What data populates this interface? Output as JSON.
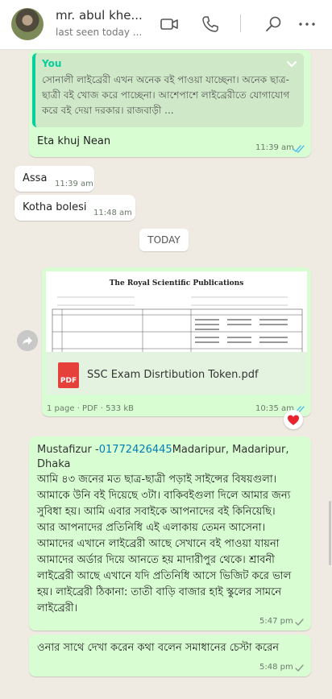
{
  "header": {
    "name": "mr. abul khe...",
    "status": "last seen today ..."
  },
  "messages": {
    "quoted_reply": {
      "quote_author": "You",
      "quote_text": "সোনালী লাইব্রেরী  এখন অনেক বই পাওয়া যাচ্ছেনা। অনেক ছাত্র-ছাত্রী বই খোজ করে পাচ্ছেনা।  আশেপাশে লাইব্রেরীতে যোগাযোগ করে বই দেয়া দরকার। রাজবাড়ী ...",
      "text": "Eta khuj Nean",
      "time": "11:39 am"
    },
    "assa": {
      "text": "Assa",
      "time": "11:39 am"
    },
    "kotha": {
      "text": "Kotha bolesi",
      "time": "11:48 am"
    },
    "date_divider": "TODAY",
    "document": {
      "preview_title": "The Royal Scientific Publications",
      "filename": "SSC Exam Disrtibution Token.pdf",
      "icon_label": "PDF",
      "meta": "1 page · PDF · 533 kB",
      "time": "10:35 am"
    },
    "long_message": {
      "sender_name": "Mustafizur -",
      "sender_phone": "01772426445",
      "sender_location": "Madaripur, Madaripur, Dhaka",
      "text": "আমি ৪৩ জনের মত ছাত্র-ছাত্রী পড়াই সাইন্সের বিষয়গুলা। আমাকে উনি বই দিয়েছে ৩টা। বাকিবইগুলা দিলে আমার জন্য সুবিধা হয়। আমি এবার সবাইকে আপনাদের বই কিনিয়েছি। আর আপনাদের প্রতিনিধি এই এলাকায় তেমন আসেনা। আমাদের এখানে লাইব্রেরী আছে সেখানে বই পাওয়া যায়না আমাদের অর্ডার দিয়ে আনতে হয় মাদারীপুর থেকে। শ্রাবনী লাইব্রেরী আছে এখানে যদি প্রতিনিধি আসে ভিজিট করে ভাল হয়। লাইব্রেরী ঠিকানা: তাতী বাড়ি বাজার হাই স্কুলের সামনে লাইব্রেরী।",
      "time": "5:47 pm"
    },
    "last_message": {
      "text": "ওনার সাথে  দেখা করেন কথা বলেন সমাধানের চেস্টা করেন",
      "time": "5:48 pm"
    }
  },
  "colors": {
    "outgoing_bubble": "#d9fdd3",
    "incoming_bubble": "#ffffff",
    "chat_background": "#efeae2",
    "quote_accent": "#06cf9c",
    "read_ticks": "#53bdeb",
    "phone_link": "#027eb5",
    "pdf_icon": "#e5403a"
  },
  "icons": [
    "video-call-icon",
    "voice-call-icon",
    "search-icon",
    "more-options-icon",
    "chevron-down-icon",
    "double-check-icon",
    "forward-icon",
    "pdf-icon",
    "heart-reaction-icon"
  ]
}
